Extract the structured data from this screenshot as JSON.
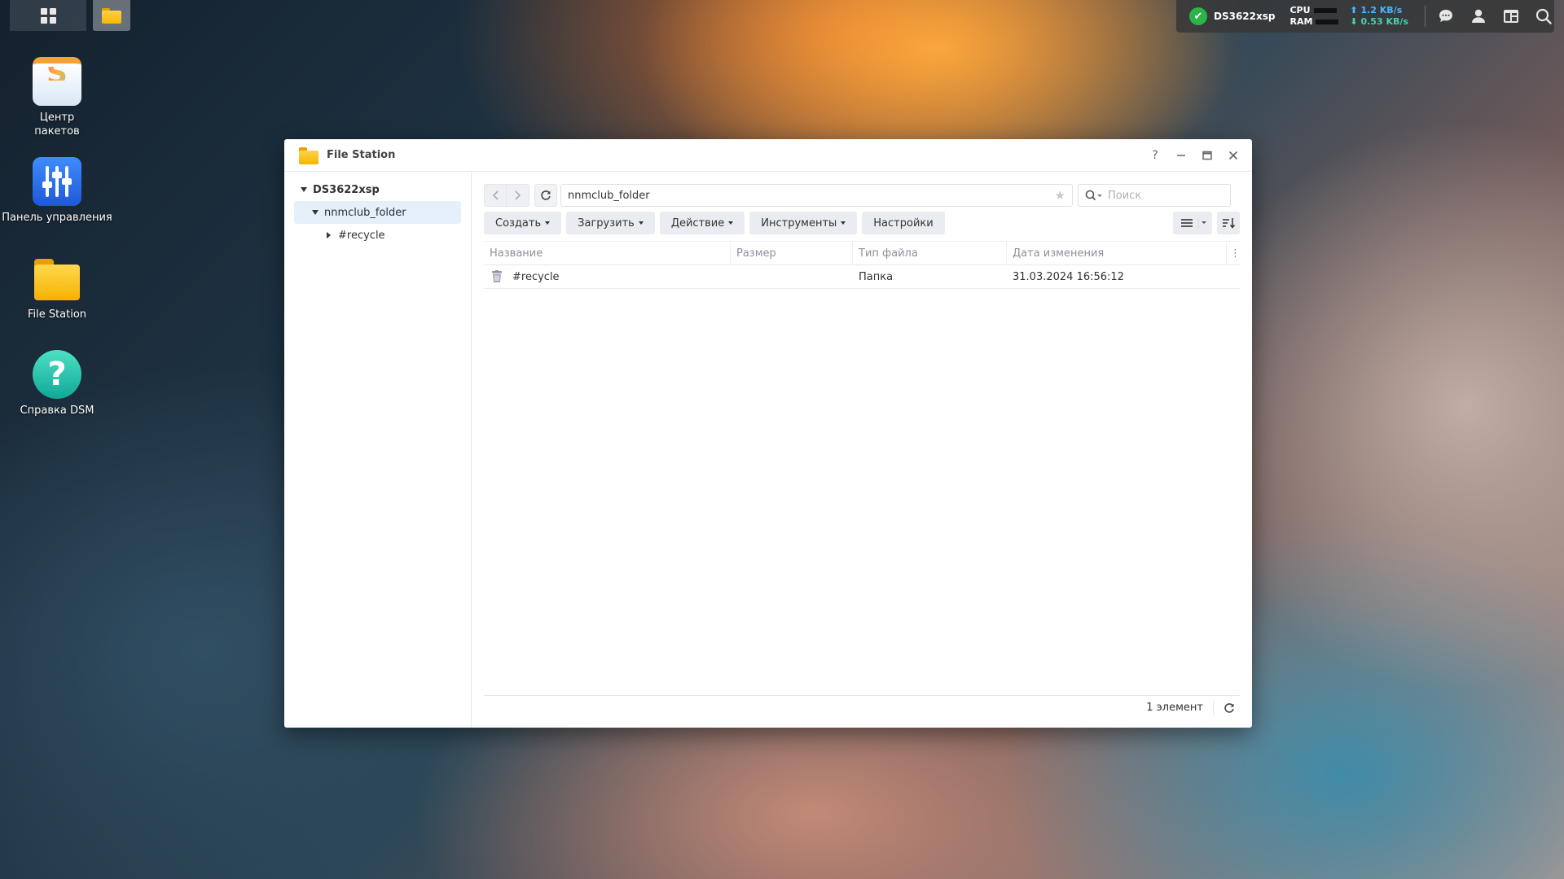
{
  "taskbar": {
    "main_menu_icon": "grid-icon",
    "active_app_icon": "file-station-icon"
  },
  "tray": {
    "server_name": "DS3622xsp",
    "cpu_label": "CPU",
    "ram_label": "RAM",
    "upload_rate": "⬆ 1.2 KB/s",
    "download_rate": "⬇ 0.53 KB/s",
    "icons": [
      "chat-icon",
      "user-icon",
      "widgets-icon",
      "search-icon"
    ]
  },
  "desktop": {
    "icons": [
      {
        "label": "Центр\nпакетов"
      },
      {
        "label": "Панель управления"
      },
      {
        "label": "File Station"
      },
      {
        "label": "Справка DSM"
      }
    ]
  },
  "window": {
    "title": "File Station",
    "controls": [
      "help-icon",
      "minimize-icon",
      "maximize-icon",
      "close-icon"
    ],
    "tree": {
      "root": "DS3622xsp",
      "folder": "nnmclub_folder",
      "child": "#recycle"
    },
    "path": "nnmclub_folder",
    "search_placeholder": "Поиск",
    "toolbar": {
      "create": "Создать",
      "upload": "Загрузить",
      "action": "Действие",
      "tools": "Инструменты",
      "settings": "Настройки"
    },
    "columns": {
      "name": "Название",
      "size": "Размер",
      "type": "Тип файла",
      "date": "Дата изменения"
    },
    "rows": [
      {
        "name": "#recycle",
        "size": "",
        "type": "Папка",
        "date": "31.03.2024 16:56:12"
      }
    ],
    "status": {
      "count": "1 элемент"
    }
  },
  "colors": {
    "accent": "#2f7de1",
    "selection": "#e5f0fb",
    "status_ok": "#2cb34a",
    "upload": "#49b6ff",
    "download": "#42d3b2"
  }
}
